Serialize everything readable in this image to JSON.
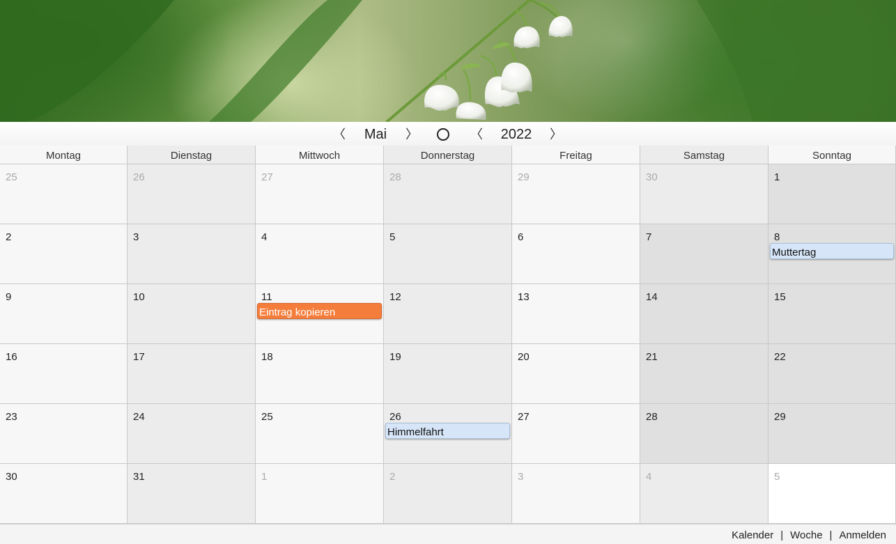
{
  "nav": {
    "prev_month": "〈",
    "month": "Mai",
    "next_month": "〉",
    "today_icon": "circle-icon",
    "prev_year": "〈",
    "year": "2022",
    "next_year": "〉"
  },
  "weekdays": [
    "Montag",
    "Dienstag",
    "Mittwoch",
    "Donnerstag",
    "Freitag",
    "Samstag",
    "Sonntag"
  ],
  "weeks": [
    [
      {
        "d": "25",
        "o": true
      },
      {
        "d": "26",
        "o": true
      },
      {
        "d": "27",
        "o": true
      },
      {
        "d": "28",
        "o": true
      },
      {
        "d": "29",
        "o": true
      },
      {
        "d": "30",
        "o": true
      },
      {
        "d": "1",
        "o": false
      }
    ],
    [
      {
        "d": "2",
        "o": false
      },
      {
        "d": "3",
        "o": false
      },
      {
        "d": "4",
        "o": false
      },
      {
        "d": "5",
        "o": false
      },
      {
        "d": "6",
        "o": false
      },
      {
        "d": "7",
        "o": false
      },
      {
        "d": "8",
        "o": false,
        "ev": "Muttertag",
        "c": "blue"
      }
    ],
    [
      {
        "d": "9",
        "o": false
      },
      {
        "d": "10",
        "o": false
      },
      {
        "d": "11",
        "o": false,
        "ev": "Eintrag kopieren",
        "c": "orange"
      },
      {
        "d": "12",
        "o": false
      },
      {
        "d": "13",
        "o": false
      },
      {
        "d": "14",
        "o": false
      },
      {
        "d": "15",
        "o": false
      }
    ],
    [
      {
        "d": "16",
        "o": false
      },
      {
        "d": "17",
        "o": false
      },
      {
        "d": "18",
        "o": false
      },
      {
        "d": "19",
        "o": false
      },
      {
        "d": "20",
        "o": false
      },
      {
        "d": "21",
        "o": false
      },
      {
        "d": "22",
        "o": false
      }
    ],
    [
      {
        "d": "23",
        "o": false
      },
      {
        "d": "24",
        "o": false
      },
      {
        "d": "25",
        "o": false
      },
      {
        "d": "26",
        "o": false,
        "ev": "Himmelfahrt",
        "c": "blue"
      },
      {
        "d": "27",
        "o": false
      },
      {
        "d": "28",
        "o": false
      },
      {
        "d": "29",
        "o": false
      }
    ],
    [
      {
        "d": "30",
        "o": false
      },
      {
        "d": "31",
        "o": false
      },
      {
        "d": "1",
        "o": true
      },
      {
        "d": "2",
        "o": true
      },
      {
        "d": "3",
        "o": true
      },
      {
        "d": "4",
        "o": true
      },
      {
        "d": "5",
        "o": true
      }
    ]
  ],
  "colors": {
    "event_blue": "#d6e6f8",
    "event_orange": "#f57d3b",
    "cell_light": "#f7f7f7",
    "cell_mid": "#ececec",
    "cell_dark": "#e0e0e0"
  },
  "footer": {
    "calendar_link": "Kalender",
    "separator": "|",
    "week_link": "Woche",
    "login_link": "Anmelden"
  }
}
